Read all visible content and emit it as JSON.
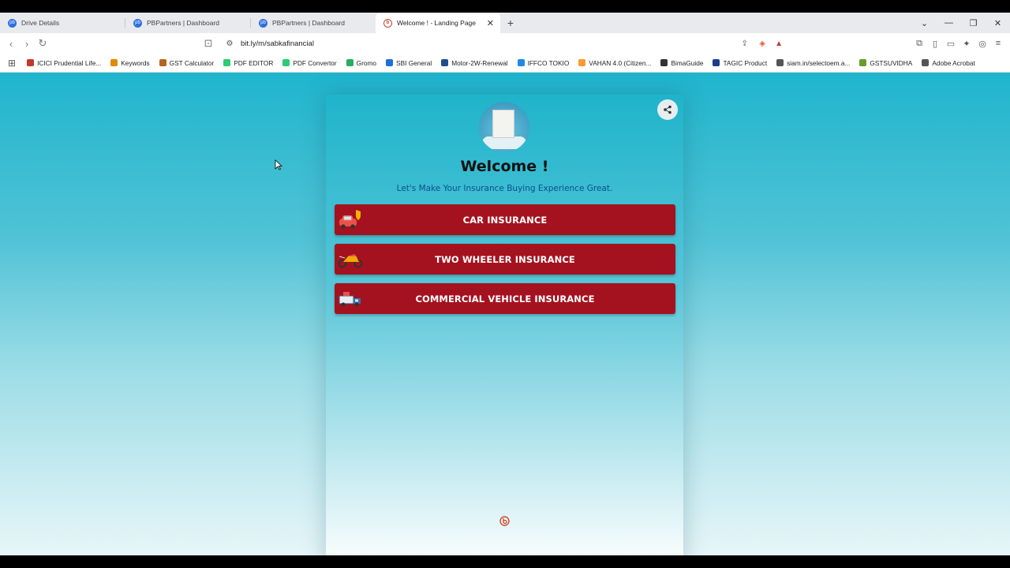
{
  "browser": {
    "tabs": [
      {
        "label": "Drive Details",
        "active": false
      },
      {
        "label": "PBPartners | Dashboard",
        "active": false
      },
      {
        "label": "PBPartners | Dashboard",
        "active": false
      },
      {
        "label": "Welcome ! - Landing Page",
        "active": true
      }
    ],
    "url": "bit.ly/m/sabkafinancial",
    "bookmarks": [
      {
        "label": "ICICI Prudential Life...",
        "color": "#c0392b"
      },
      {
        "label": "Keywords",
        "color": "#e08a00"
      },
      {
        "label": "GST Calculator",
        "color": "#b5651d"
      },
      {
        "label": "PDF EDITOR",
        "color": "#2ecc71"
      },
      {
        "label": "PDF Convertor",
        "color": "#2ecc71"
      },
      {
        "label": "Gromo",
        "color": "#27ae60"
      },
      {
        "label": "SBI General",
        "color": "#1e6fd9"
      },
      {
        "label": "Motor-2W-Renewal",
        "color": "#1f4e8c"
      },
      {
        "label": "IFFCO TOKIO",
        "color": "#1e88e5"
      },
      {
        "label": "VAHAN 4.0 (Citizen...",
        "color": "#ff9933"
      },
      {
        "label": "BimaGuide",
        "color": "#333333"
      },
      {
        "label": "TAGIC Product",
        "color": "#1a3e8c"
      },
      {
        "label": "siam.in/selectoem.a...",
        "color": "#555555"
      },
      {
        "label": "GSTSUVIDHA",
        "color": "#6a9a2b"
      },
      {
        "label": "Adobe Acrobat",
        "color": "#555555"
      }
    ]
  },
  "page": {
    "welcome_title": "Welcome !",
    "tagline": "Let's Make Your Insurance Buying Experience Great.",
    "buttons": [
      {
        "label": "CAR INSURANCE",
        "icon": "car-shield-icon"
      },
      {
        "label": "TWO WHEELER INSURANCE",
        "icon": "motorbike-icon"
      },
      {
        "label": "COMMERCIAL VEHICLE INSURANCE",
        "icon": "truck-icon"
      }
    ]
  },
  "colors": {
    "button_bg": "#a5121f",
    "title_color": "#111111",
    "tagline_color": "#0d4f8c",
    "bg_top": "#1fb5cd",
    "bg_bottom": "#e7f6f8"
  }
}
